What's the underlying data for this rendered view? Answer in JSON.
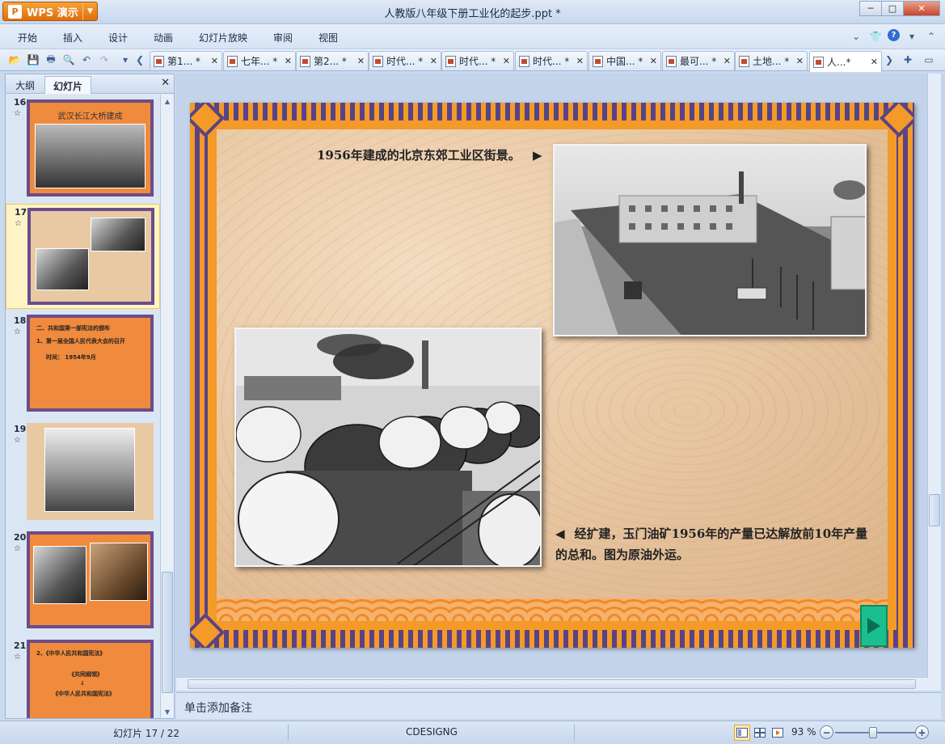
{
  "app": {
    "name": "WPS 演示",
    "logo_glyph": "P",
    "doc_title": "人教版八年级下册工业化的起步.ppt *",
    "win_minimize": "─",
    "win_maximize": "□",
    "win_close": "✕"
  },
  "menu": [
    "开始",
    "插入",
    "设计",
    "动画",
    "幻灯片放映",
    "审阅",
    "视图"
  ],
  "tabs": [
    {
      "label": "第1... *"
    },
    {
      "label": "七年... *"
    },
    {
      "label": "第2... *"
    },
    {
      "label": "时代... *"
    },
    {
      "label": "时代... *"
    },
    {
      "label": "时代... *"
    },
    {
      "label": "中国... *"
    },
    {
      "label": "最可... *"
    },
    {
      "label": "土地... *"
    },
    {
      "label": "人...*"
    }
  ],
  "panel": {
    "tab_outline": "大纲",
    "tab_slides": "幻灯片",
    "close_glyph": "✕"
  },
  "thumbnails": [
    {
      "num": "16",
      "star": "☆",
      "title": "武汉长江大桥建成"
    },
    {
      "num": "17",
      "star": "☆",
      "selected": true
    },
    {
      "num": "18",
      "star": "☆",
      "lines": [
        "二、共和国第一部宪法的颁布",
        "1、第一届全国人民代表大会的召开",
        "时间：      1954年9月"
      ]
    },
    {
      "num": "19",
      "star": "☆"
    },
    {
      "num": "20",
      "star": "☆"
    },
    {
      "num": "21",
      "star": "☆",
      "lines": [
        "2、《中华人民共和国宪法》",
        "《共同纲领》",
        "↓",
        "《中华人民共和国宪法》"
      ]
    }
  ],
  "slide": {
    "caption_top": "1956年建成的北京东郊工业区街景。",
    "arrow_right": "▶",
    "arrow_left": "◀",
    "caption_bottom": "经扩建，玉门油矿1956年的产量已达解放前10年产量的总和。图为原油外运。"
  },
  "notes": {
    "placeholder": "单击添加备注"
  },
  "status": {
    "slide_info": "幻灯片 17 / 22",
    "theme": "CDESIGNG",
    "zoom": "93 %",
    "zoom_level": 0.47,
    "zoom_minus": "−",
    "zoom_plus": "+"
  }
}
